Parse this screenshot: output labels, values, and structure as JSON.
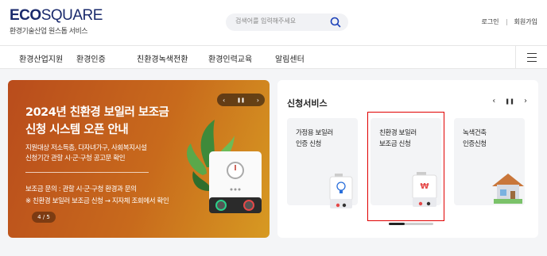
{
  "header": {
    "logo_main": "ECO",
    "logo_main_light": "SQUARE",
    "logo_sub": "환경기술산업 원스톱 서비스",
    "search_placeholder": "검색어를 입력해주세요",
    "login": "로그인",
    "signup": "회원가입"
  },
  "nav": {
    "items": [
      "환경산업지원",
      "환경인증",
      "친환경녹색전환",
      "환경인력교육",
      "알림센터"
    ]
  },
  "banner": {
    "title_line1": "2024년 친환경 보일러 보조금",
    "title_line2": "신청 시스템 오픈 안내",
    "desc_line1": "지원대상 저소득층, 다자녀가구, 사회복지시설",
    "desc_line2": "신청기간 관할 시·군·구청 공고문 확인",
    "contact_line1": "보조금 문의 : 관할 시·군·구청 환경과 문의",
    "contact_line2": "※ 친환경 보일러 보조금 신청 → 지자체 조회에서 확인",
    "pager": "4 / 5",
    "ctrl_prev": "‹",
    "ctrl_pause": "❚❚",
    "ctrl_next": "›"
  },
  "service": {
    "title": "신청서비스",
    "ctrl_prev": "‹",
    "ctrl_pause": "❚❚",
    "ctrl_next": "›",
    "cards": [
      {
        "line1": "가정용 보일러",
        "line2": "인증 신청",
        "icon": "boiler-bulb-icon"
      },
      {
        "line1": "친환경 보일러",
        "line2": "보조금 신청",
        "icon": "boiler-won-icon"
      },
      {
        "line1": "녹색건축",
        "line2": "인증신청",
        "icon": "house-icon"
      }
    ]
  },
  "colors": {
    "brand": "#1a2a6c",
    "highlight": "#e00000",
    "banner_start": "#b94c1c",
    "banner_end": "#d79a22"
  }
}
